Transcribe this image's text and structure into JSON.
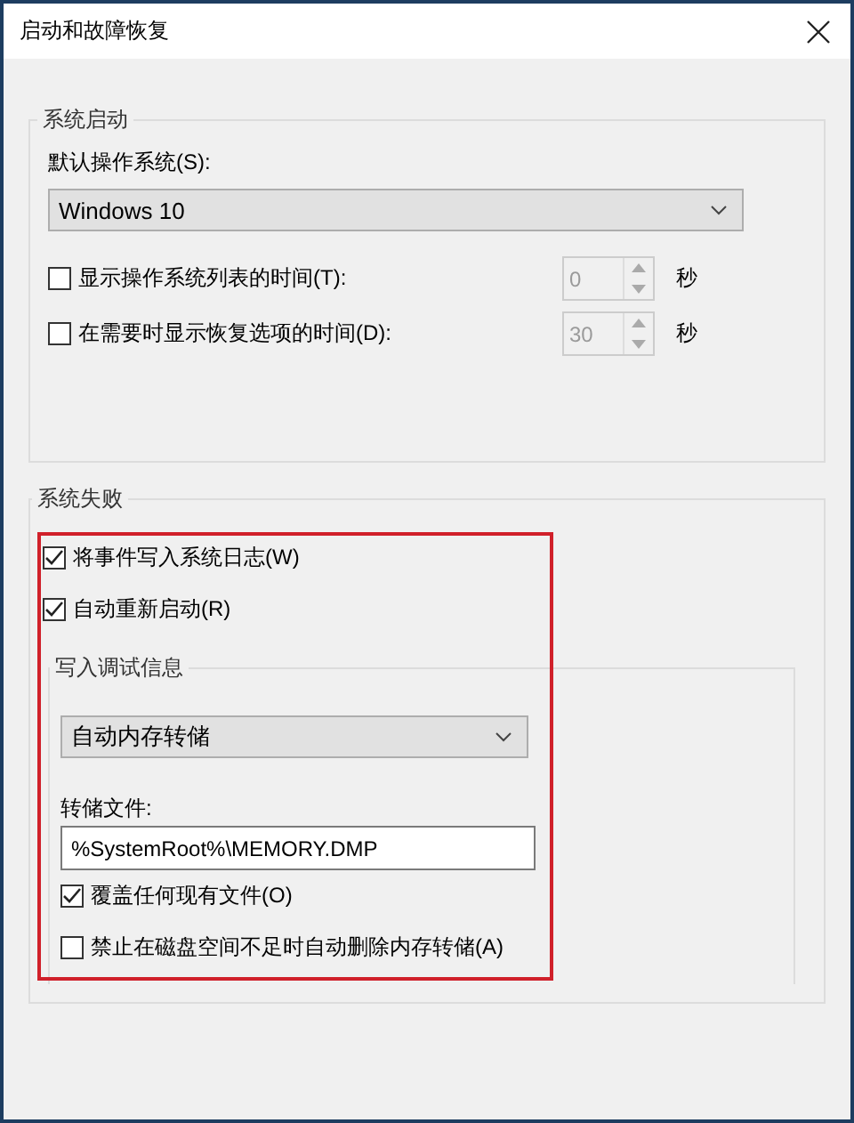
{
  "window": {
    "title": "启动和故障恢复"
  },
  "system_startup": {
    "title": "系统启动",
    "default_os_label": "默认操作系统(S):",
    "default_os": "Windows 10",
    "options": [
      {
        "label": "显示操作系统列表的时间(T):",
        "checked": false,
        "value": "0",
        "disabled": true,
        "unit": "秒"
      },
      {
        "label": "在需要时显示恢复选项的时间(D):",
        "checked": false,
        "value": "30",
        "disabled": true,
        "unit": "秒"
      }
    ]
  },
  "system_failure": {
    "title": "系统失败",
    "options": [
      {
        "label": "将事件写入系统日志(W)",
        "checked": true
      },
      {
        "label": "自动重新启动(R)",
        "checked": true
      }
    ],
    "debug_info": {
      "title": "写入调试信息",
      "dump_type": "自动内存转储",
      "dump_file_label": "转储文件:",
      "dump_file": "%SystemRoot%\\MEMORY.DMP",
      "options": [
        {
          "label": "覆盖任何现有文件(O)",
          "checked": true
        },
        {
          "label": "禁止在磁盘空间不足时自动删除内存转储(A)",
          "checked": false
        }
      ]
    }
  },
  "highlight": true
}
